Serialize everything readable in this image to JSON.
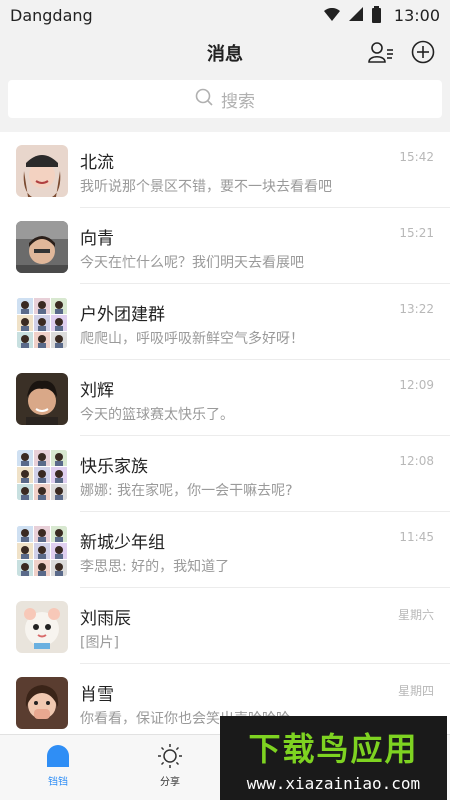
{
  "status_bar": {
    "carrier": "Dangdang",
    "time": "13:00"
  },
  "nav": {
    "title": "消息"
  },
  "search": {
    "placeholder": "搜索"
  },
  "conversations": [
    {
      "name": "北流",
      "message": "我听说那个景区不错，要不一块去看看吧",
      "time": "15:42",
      "avatar": "girl-hat"
    },
    {
      "name": "向青",
      "message": "今天在忙什么呢？我们明天去看展吧",
      "time": "15:21",
      "avatar": "car-selfie"
    },
    {
      "name": "户外团建群",
      "message": "爬爬山，呼吸呼吸新鲜空气多好呀！",
      "time": "13:22",
      "avatar": "group-grid"
    },
    {
      "name": "刘辉",
      "message": "今天的篮球赛太快乐了。",
      "time": "12:09",
      "avatar": "boy-portrait"
    },
    {
      "name": "快乐家族",
      "message": "娜娜: 我在家呢，你一会干嘛去呢?",
      "time": "12:08",
      "avatar": "group-grid"
    },
    {
      "name": "新城少年组",
      "message": "李思思: 好的，我知道了",
      "time": "11:45",
      "avatar": "group-grid"
    },
    {
      "name": "刘雨辰",
      "message": "[图片]",
      "time": "星期六",
      "avatar": "plush-toy"
    },
    {
      "name": "肖雪",
      "message": "你看看，保证你也会笑出声哈哈哈",
      "time": "星期四",
      "avatar": "girl-laugh"
    }
  ],
  "tabs": [
    {
      "label": "铛铛",
      "icon": "bell-icon",
      "active": true
    },
    {
      "label": "分享",
      "icon": "sun-icon",
      "active": false
    }
  ],
  "watermark": {
    "title": "下载鸟应用",
    "url": "www.xiazainiao.com"
  },
  "colors": {
    "accent": "#2f8ef5",
    "background": "#f2f2f2",
    "watermark_green": "#7ed321"
  }
}
